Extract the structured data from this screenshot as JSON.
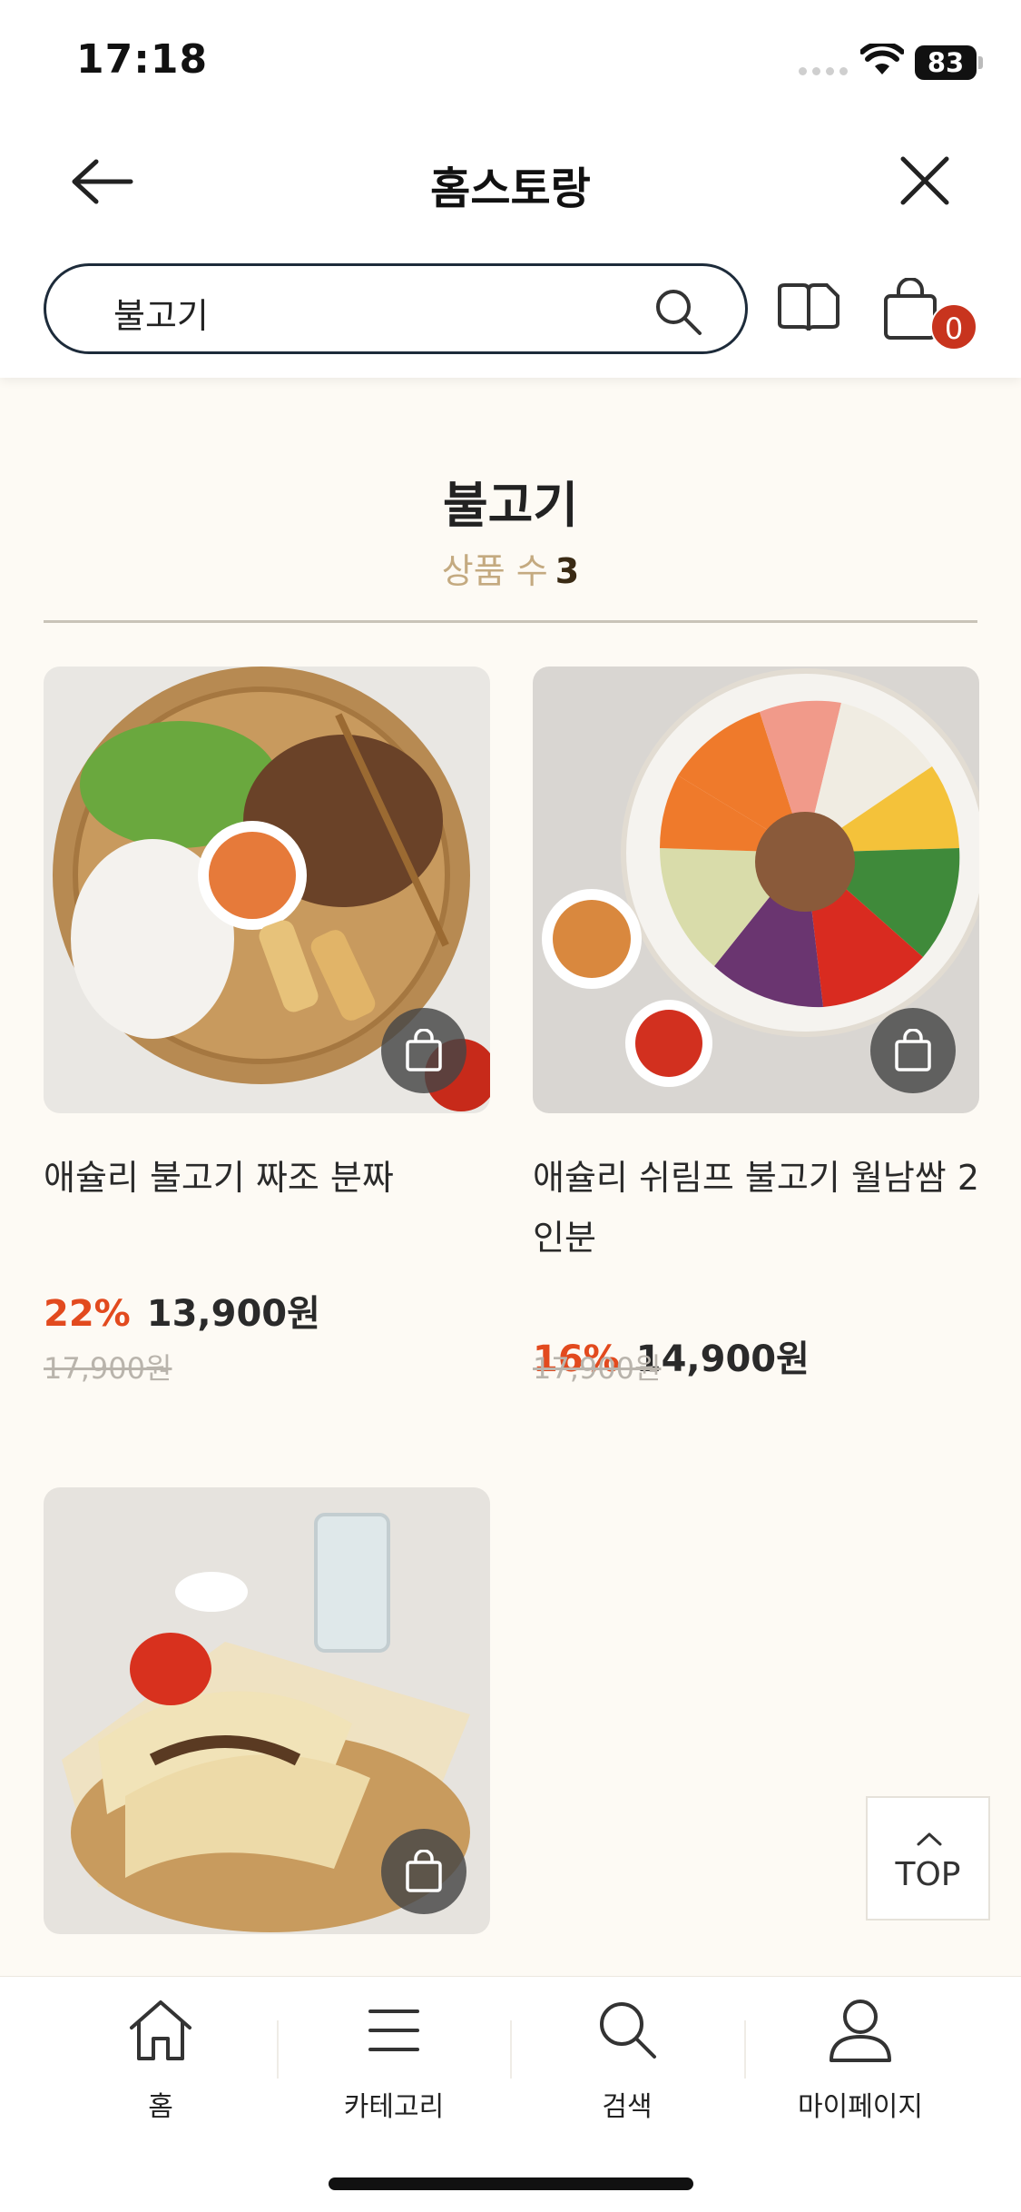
{
  "status_bar": {
    "time": "17:18",
    "battery": "83"
  },
  "header": {
    "title": "홈스토랑"
  },
  "search": {
    "value": "불고기"
  },
  "cart": {
    "badge": "0"
  },
  "results": {
    "heading": "불고기",
    "count_label": "상품 수",
    "count": "3"
  },
  "products": [
    {
      "name": "애슐리 불고기 짜조 분짜",
      "discount": "22%",
      "price": "13,900원",
      "original_price": "17,900원"
    },
    {
      "name": "애슐리 쉬림프 불고기 월남쌈 2인분",
      "discount": "16%",
      "price": "14,900원",
      "original_price": "17,900원"
    },
    {
      "name": "",
      "discount": "",
      "price": "",
      "original_price": ""
    }
  ],
  "top_button": {
    "label": "TOP"
  },
  "tabbar": {
    "items": [
      {
        "label": "홈",
        "icon": "home-icon"
      },
      {
        "label": "카테고리",
        "icon": "menu-icon"
      },
      {
        "label": "검색",
        "icon": "search-icon"
      },
      {
        "label": "마이페이지",
        "icon": "user-icon"
      }
    ]
  }
}
